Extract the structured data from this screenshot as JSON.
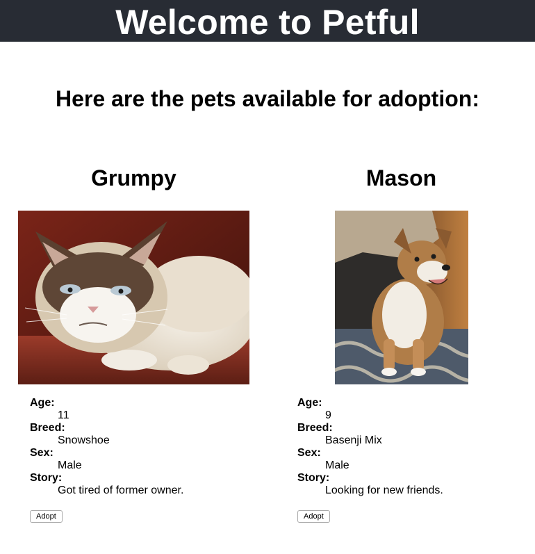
{
  "header": {
    "title": "Welcome to Petful"
  },
  "subtitle": "Here are the pets available for adoption:",
  "pets": [
    {
      "name": "Grumpy",
      "image": "grumpy-cat-photo",
      "labels": {
        "age": "Age:",
        "breed": "Breed:",
        "sex": "Sex:",
        "story": "Story:"
      },
      "age": "11",
      "breed": "Snowshoe",
      "sex": "Male",
      "story": "Got tired of former owner.",
      "adopt_label": "Adopt"
    },
    {
      "name": "Mason",
      "image": "mason-dog-photo",
      "labels": {
        "age": "Age:",
        "breed": "Breed:",
        "sex": "Sex:",
        "story": "Story:"
      },
      "age": "9",
      "breed": "Basenji Mix",
      "sex": "Male",
      "story": "Looking for new friends.",
      "adopt_label": "Adopt"
    }
  ],
  "colors": {
    "header_bg": "#282c34",
    "header_text": "#ffffff"
  }
}
